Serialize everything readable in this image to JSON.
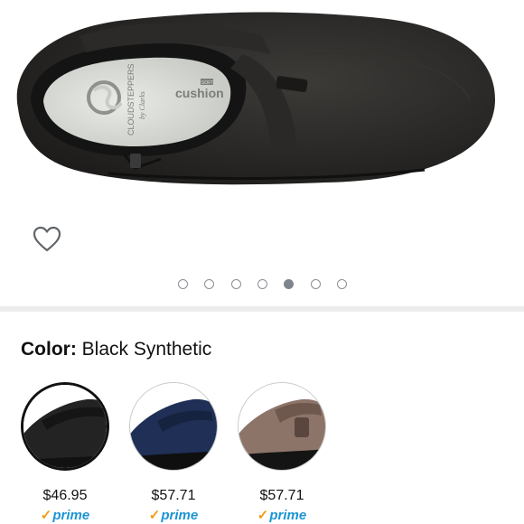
{
  "product": {
    "insole_brand_text": "CLOUDSTEPPERS",
    "insole_sub_text": "by Clarks",
    "insole_cushion_text": "cushion",
    "insole_soft_text": "SOFT"
  },
  "gallery": {
    "image_count": 7,
    "active_index": 4
  },
  "color": {
    "label": "Color:",
    "value": "Black Synthetic"
  },
  "variants": [
    {
      "name": "Black Synthetic",
      "price": "$46.95",
      "prime": "prime",
      "selected": true,
      "hex": "#242424"
    },
    {
      "name": "Navy",
      "price": "$57.71",
      "prime": "prime",
      "selected": false,
      "hex": "#1f2f55"
    },
    {
      "name": "Taupe",
      "price": "$57.71",
      "prime": "prime",
      "selected": false,
      "hex": "#8d7468"
    }
  ],
  "icons": {
    "wishlist": "heart-outline-icon",
    "prime_check": "checkmark-icon"
  },
  "colors": {
    "prime_blue": "#1c94d4",
    "prime_check": "#f39c12",
    "divider": "#ececec"
  }
}
